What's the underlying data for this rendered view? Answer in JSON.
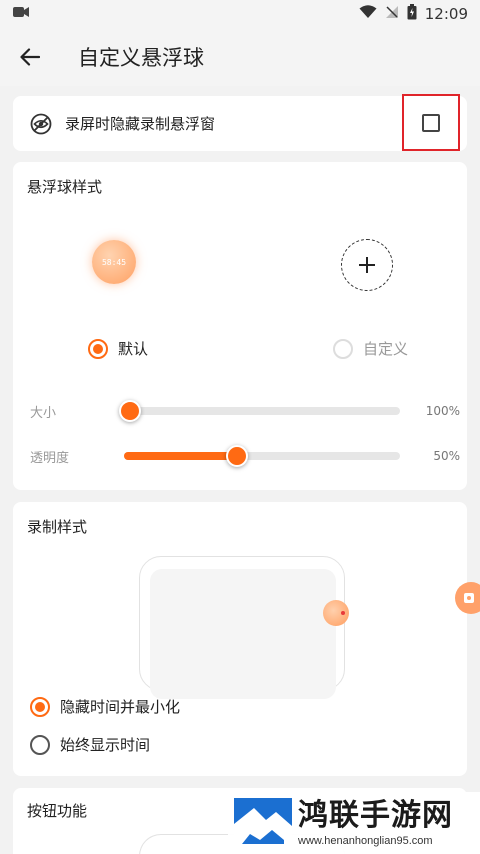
{
  "status_bar": {
    "time": "12:09"
  },
  "app_bar": {
    "title": "自定义悬浮球"
  },
  "hide_row": {
    "label": "录屏时隐藏录制悬浮窗",
    "checked": false
  },
  "ball_style": {
    "title": "悬浮球样式",
    "preview_time": "58:45",
    "options": [
      {
        "label": "默认",
        "selected": true
      },
      {
        "label": "自定义",
        "selected": false
      }
    ],
    "sliders": [
      {
        "label": "大小",
        "value_text": "100%",
        "fraction": 0.0
      },
      {
        "label": "透明度",
        "value_text": "50%",
        "fraction": 0.41
      }
    ]
  },
  "record_style": {
    "title": "录制样式",
    "options": [
      {
        "label": "隐藏时间并最小化",
        "selected": true
      },
      {
        "label": "始终显示时间",
        "selected": false
      }
    ]
  },
  "button_function": {
    "title": "按钮功能"
  },
  "watermark": {
    "name": "鸿联手游网",
    "url": "www.henanhonglian95.com"
  },
  "colors": {
    "accent": "#ff6a13",
    "highlight_frame": "#e0242a",
    "background": "#f2f2f2"
  },
  "icons": [
    "camera-indicator-icon",
    "wifi-icon",
    "signal-off-icon",
    "battery-icon",
    "back-arrow-icon",
    "eye-off-icon",
    "plus-icon",
    "record-icon"
  ]
}
